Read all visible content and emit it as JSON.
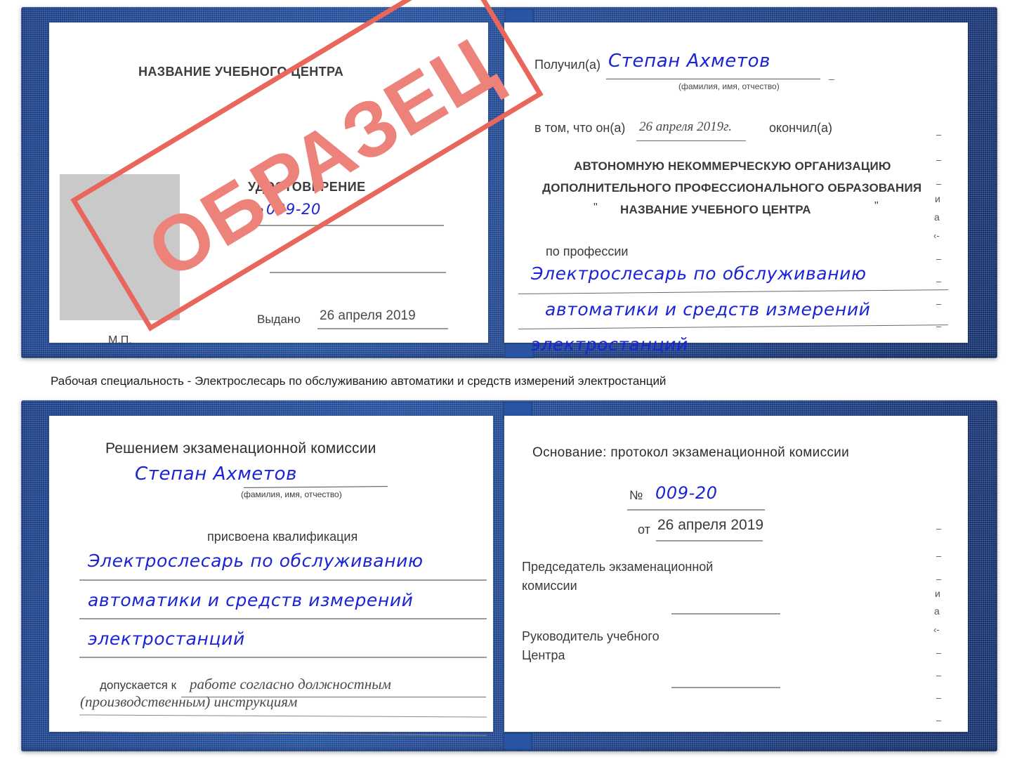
{
  "caption": {
    "text": "Рабочая специальность - Электрослесарь по обслуживанию автоматики и средств измерений электростанций"
  },
  "stamp": {
    "word": "ОБРАЗЕЦ",
    "color": "#e8665c"
  },
  "colors": {
    "cover_blue": "#1f4590",
    "handwriting_blue": "#1a23d8",
    "stamp_red": "#e8665c",
    "photo_gray": "#c9c9c9",
    "rule_gray": "#9b9b9b"
  },
  "certificate_top": {
    "left_page": {
      "org_title": "НАЗВАНИЕ УЧЕБНОГО ЦЕНТРА",
      "doc_type": "УДОСТОВЕРЕНИЕ",
      "number_label": "№",
      "number_value": "009-20",
      "issued_label": "Выдано",
      "issued_value": "26 апреля 2019",
      "seal_label": "М.П.",
      "photo_placeholder": ""
    },
    "right_page": {
      "received_label": "Получил(а)",
      "received_value": "Степан Ахметов",
      "fio_hint": "(фамилия, имя, отчество)",
      "that_label": "в том, что он(а)",
      "that_date": "26 апреля 2019г.",
      "finished_label": "окончил(а)",
      "org_line1": "АВТОНОМНУЮ НЕКОММЕРЧЕСКУЮ ОРГАНИЗАЦИЮ",
      "org_line2": "ДОПОЛНИТЕЛЬНОГО ПРОФЕССИОНАЛЬНОГО ОБРАЗОВАНИЯ",
      "org_quote_open": "\"",
      "org_line3": "НАЗВАНИЕ УЧЕБНОГО ЦЕНТРА",
      "org_quote_close": "\"",
      "profession_label": "по профессии",
      "profession_line1": "Электрослесарь по обслуживанию",
      "profession_line2": "автоматики и средств измерений",
      "profession_line3": "электростанций",
      "edge_marks": [
        "–",
        "–",
        "–",
        "и",
        "а",
        "‹-",
        "–",
        "–",
        "–",
        "–"
      ]
    }
  },
  "certificate_bottom": {
    "left_page": {
      "heading": "Решением экзаменационной комиссии",
      "name_value": "Степан Ахметов",
      "fio_hint": "(фамилия, имя, отчество)",
      "qualification_label": "присвоена квалификация",
      "qualification_line1": "Электрослесарь по обслуживанию",
      "qualification_line2": "автоматики и средств измерений",
      "qualification_line3": "электростанций",
      "admitted_label": "допускается к",
      "admitted_line1": "работе согласно должностным",
      "admitted_line2": "(производственным) инструкциям"
    },
    "right_page": {
      "basis_label": "Основание: протокол экзаменационной комиссии",
      "number_label": "№",
      "number_value": "009-20",
      "date_label": "от",
      "date_value": "26 апреля 2019",
      "chairman_line1": "Председатель экзаменационной",
      "chairman_line2": "комиссии",
      "head_line1": "Руководитель учебного",
      "head_line2": "Центра",
      "edge_marks": [
        "–",
        "–",
        "–",
        "и",
        "а",
        "‹-",
        "–",
        "–",
        "–",
        "–"
      ]
    }
  }
}
